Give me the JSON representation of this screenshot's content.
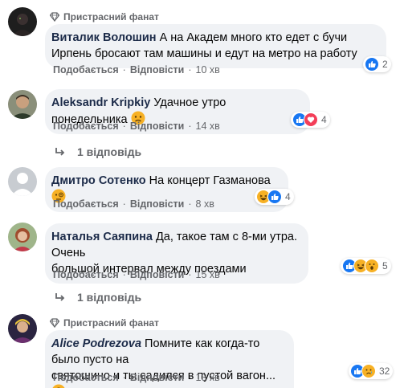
{
  "comments": [
    {
      "badge": "Пристрасний фанат",
      "author": "Виталик Волошин",
      "text_line1": "А на Академ много кто едет с бучи",
      "text_line2": "Ирпень бросают там машины и едут на метро на работу",
      "reaction_count": "2",
      "like": "Подобається",
      "reply": "Відповісти",
      "time": "10 хв"
    },
    {
      "author": "Aleksandr Kripkiy",
      "text_line1": "Удачное утро понедельника",
      "reaction_count": "4",
      "like": "Подобається",
      "reply": "Відповісти",
      "time": "14 хв",
      "replies": "1 відповідь"
    },
    {
      "author": "Дмитро Сотенко",
      "text_line1": "На концерт Газманова",
      "reaction_count": "4",
      "like": "Подобається",
      "reply": "Відповісти",
      "time": "8 хв"
    },
    {
      "author": "Наталья Саяпина",
      "text_line1": "Да, такое там с 8-ми утра. Очень",
      "text_line2": "большой интервал между поездами",
      "reaction_count": "5",
      "like": "Подобається",
      "reply": "Відповісти",
      "time": "15 хв",
      "replies": "1 відповідь"
    },
    {
      "badge": "Пристрасний фанат",
      "author": "Alice Podrezova",
      "text_line1": "Помните как когда-то было пусто на",
      "text_line2": "святошино и ты садился в пустой вагон...",
      "reaction_count": "32",
      "like": "Подобається",
      "reply": "Відповісти",
      "time": "13 хв"
    }
  ],
  "separator": "·",
  "colors": {
    "bubble": "#f0f2f5",
    "author": "#1c2b49",
    "meta": "#65676b",
    "like_blue": "#1877f2",
    "love_red": "#f33e58",
    "emoji_yellow": "#f7b125"
  }
}
